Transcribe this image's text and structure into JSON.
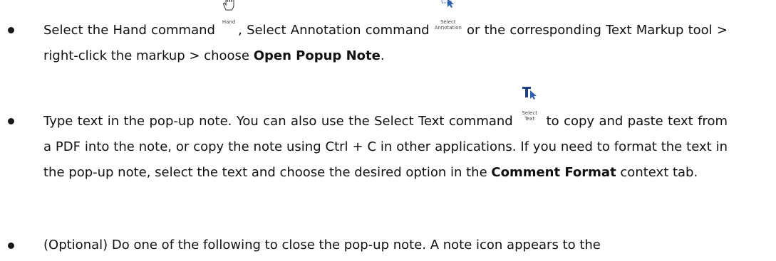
{
  "bullets": [
    {
      "t1": "Select the Hand command ",
      "hand_caption": "Hand",
      "t2": ", Select Annotation command ",
      "select_annotation_caption": "Select Annotation",
      "t3": " or the corresponding Text Markup tool > right-click the markup > choose ",
      "bold1": "Open Popup Note",
      "t4": "."
    },
    {
      "t1": "Type text in the pop-up note. You can also use the Select Text command ",
      "select_text_caption": "Select Text",
      "t2": " to copy and paste text from a PDF into the note, or copy the note using Ctrl + C in other applications. If you need to format the text in the pop-up note, select the text and choose the desired option in the ",
      "bold1": "Comment Format",
      "t3": " context tab."
    },
    {
      "t1": "(Optional) Do one of the following to close the pop-up note. A note icon appears to the"
    }
  ],
  "colors": {
    "icon_blue": "#2e5fb2",
    "text": "#111111"
  },
  "icons": [
    "hand-icon",
    "select-annotation-icon",
    "select-text-icon"
  ]
}
